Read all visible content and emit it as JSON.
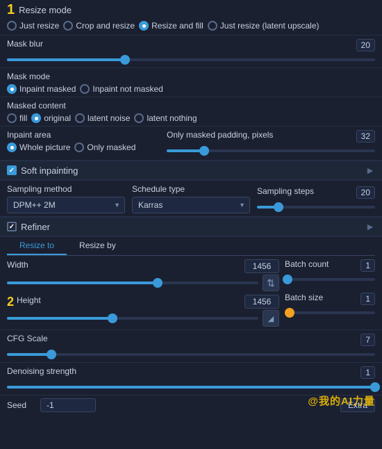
{
  "resize_mode": {
    "label": "Resize mode",
    "step": "1",
    "options": [
      {
        "id": "just-resize",
        "label": "Just resize",
        "selected": false
      },
      {
        "id": "crop-and-resize",
        "label": "Crop and resize",
        "selected": false
      },
      {
        "id": "resize-and-fill",
        "label": "Resize and fill",
        "selected": true
      },
      {
        "id": "just-resize-latent",
        "label": "Just resize (latent upscale)",
        "selected": false
      }
    ]
  },
  "mask_blur": {
    "label": "Mask blur",
    "value": 20,
    "fill_pct": 32
  },
  "mask_mode": {
    "label": "Mask mode",
    "options": [
      {
        "id": "inpaint-masked",
        "label": "Inpaint masked",
        "selected": true
      },
      {
        "id": "inpaint-not-masked",
        "label": "Inpaint not masked",
        "selected": false
      }
    ]
  },
  "masked_content": {
    "label": "Masked content",
    "options": [
      {
        "id": "fill",
        "label": "fill",
        "selected": false
      },
      {
        "id": "original",
        "label": "original",
        "selected": true
      },
      {
        "id": "latent-noise",
        "label": "latent noise",
        "selected": false
      },
      {
        "id": "latent-nothing",
        "label": "latent nothing",
        "selected": false
      }
    ]
  },
  "inpaint_area": {
    "label": "Inpaint area",
    "options": [
      {
        "id": "whole-picture",
        "label": "Whole picture",
        "selected": true
      },
      {
        "id": "only-masked",
        "label": "Only masked",
        "selected": false
      }
    ]
  },
  "only_masked_padding": {
    "label": "Only masked padding, pixels",
    "value": 32,
    "fill_pct": 18
  },
  "soft_inpainting": {
    "label": "Soft inpainting",
    "checked": true
  },
  "sampling": {
    "method_label": "Sampling method",
    "method_value": "DPM++ 2M",
    "schedule_label": "Schedule type",
    "schedule_value": "Karras",
    "steps_label": "Sampling steps",
    "steps_value": 20,
    "steps_fill_pct": 18
  },
  "refiner": {
    "label": "Refiner",
    "checked": false
  },
  "resize_tabs": [
    {
      "id": "resize-to",
      "label": "Resize to",
      "active": true
    },
    {
      "id": "resize-by",
      "label": "Resize by",
      "active": false
    }
  ],
  "width": {
    "label": "Width",
    "value": 1456,
    "fill_pct": 60
  },
  "height": {
    "label": "Height",
    "step": "2",
    "value": 1456,
    "fill_pct": 42
  },
  "batch_count": {
    "label": "Batch count",
    "value": 1,
    "fill_pct": 0
  },
  "batch_size": {
    "label": "Batch size",
    "value": 1,
    "fill_pct": 5
  },
  "cfg_scale": {
    "label": "CFG Scale",
    "value": 7,
    "fill_pct": 12
  },
  "denoising_strength": {
    "label": "Denoising strength",
    "value": 1,
    "fill_pct": 100
  },
  "seed": {
    "label": "Seed",
    "value": "-1",
    "extra_btn": "Extra"
  },
  "watermark": "@我的AI力量"
}
